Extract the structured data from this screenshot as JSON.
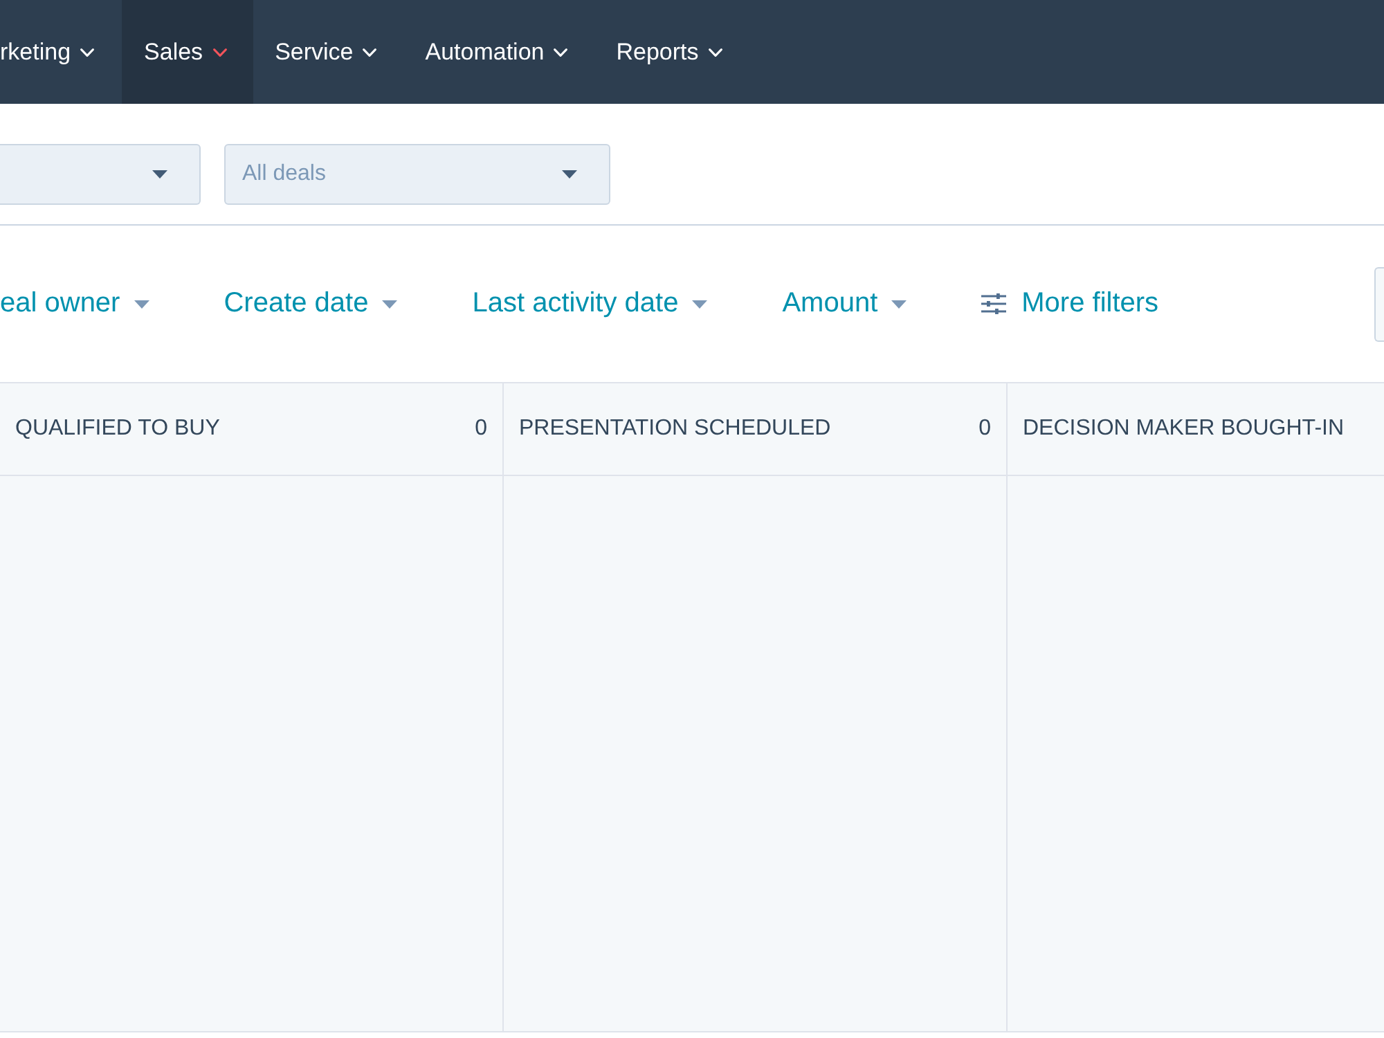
{
  "nav": {
    "items": [
      {
        "label": "rketing",
        "selected": false
      },
      {
        "label": "Sales",
        "selected": true
      },
      {
        "label": "Service",
        "selected": false
      },
      {
        "label": "Automation",
        "selected": false
      },
      {
        "label": "Reports",
        "selected": false
      }
    ]
  },
  "dropdowns": [
    {
      "kind": "blank"
    },
    {
      "kind": "select",
      "value": "All deals"
    }
  ],
  "filters": [
    {
      "kind": "dropdown",
      "label": "eal owner"
    },
    {
      "kind": "dropdown",
      "label": "Create date"
    },
    {
      "kind": "dropdown",
      "label": "Last activity date"
    },
    {
      "kind": "dropdown",
      "label": "Amount"
    },
    {
      "kind": "more",
      "label": "More filters"
    }
  ],
  "edge_button": true,
  "stages": [
    {
      "name": "QUALIFIED TO BUY",
      "count": "0"
    },
    {
      "name": "PRESENTATION SCHEDULED",
      "count": "0"
    },
    {
      "name": "DECISION MAKER BOUGHT-IN"
    }
  ]
}
